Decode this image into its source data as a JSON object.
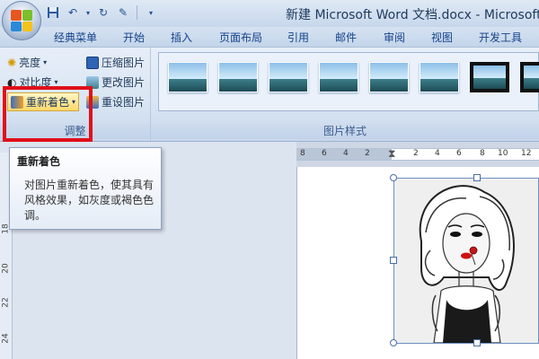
{
  "window": {
    "title": "新建 Microsoft Word 文档.docx - Microsoft Wo"
  },
  "quick_access": {
    "icons": [
      "save-icon",
      "undo-icon",
      "redo-icon",
      "paint-icon"
    ]
  },
  "tabs": [
    "经典菜单",
    "开始",
    "插入",
    "页面布局",
    "引用",
    "邮件",
    "审阅",
    "视图",
    "开发工具"
  ],
  "ribbon": {
    "adjust_group": {
      "label": "调整",
      "brightness": "亮度",
      "contrast": "对比度",
      "recolor": "重新着色",
      "compress": "压缩图片",
      "change_picture": "更改图片",
      "reset_picture": "重设图片"
    },
    "styles_group": {
      "label": "图片样式",
      "style_count": 7
    }
  },
  "tooltip": {
    "title": "重新着色",
    "body": "对图片重新着色，使其具有风格效果，如灰度或褐色色调。"
  },
  "ruler": {
    "horizontal": [
      "8",
      "6",
      "4",
      "2",
      "2",
      "4",
      "6",
      "8",
      "10",
      "12"
    ],
    "vertical": [
      "18",
      "20",
      "22",
      "24"
    ]
  },
  "colors": {
    "highlight": "#e0101a",
    "ribbon": "#dce6f4"
  }
}
